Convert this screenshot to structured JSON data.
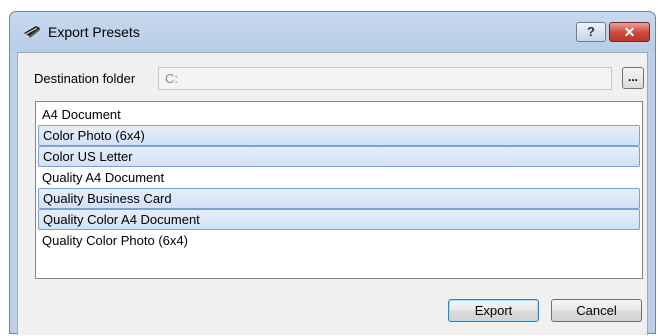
{
  "window": {
    "title": "Export Presets",
    "help_label": "?",
    "close_label": "✕"
  },
  "destination": {
    "label": "Destination folder",
    "value": "C:",
    "browse_label": "..."
  },
  "presets": [
    {
      "label": "A4 Document",
      "selected": false
    },
    {
      "label": "Color Photo (6x4)",
      "selected": true
    },
    {
      "label": "Color US Letter",
      "selected": true
    },
    {
      "label": "Quality A4 Document",
      "selected": false
    },
    {
      "label": "Quality Business Card",
      "selected": true
    },
    {
      "label": "Quality Color A4 Document",
      "selected": true
    },
    {
      "label": "Quality Color Photo (6x4)",
      "selected": false
    }
  ],
  "buttons": {
    "export_label": "Export",
    "cancel_label": "Cancel"
  },
  "colors": {
    "frame": "#bcd1e9",
    "selection": "#d1e1f6",
    "close": "#c9483a"
  }
}
